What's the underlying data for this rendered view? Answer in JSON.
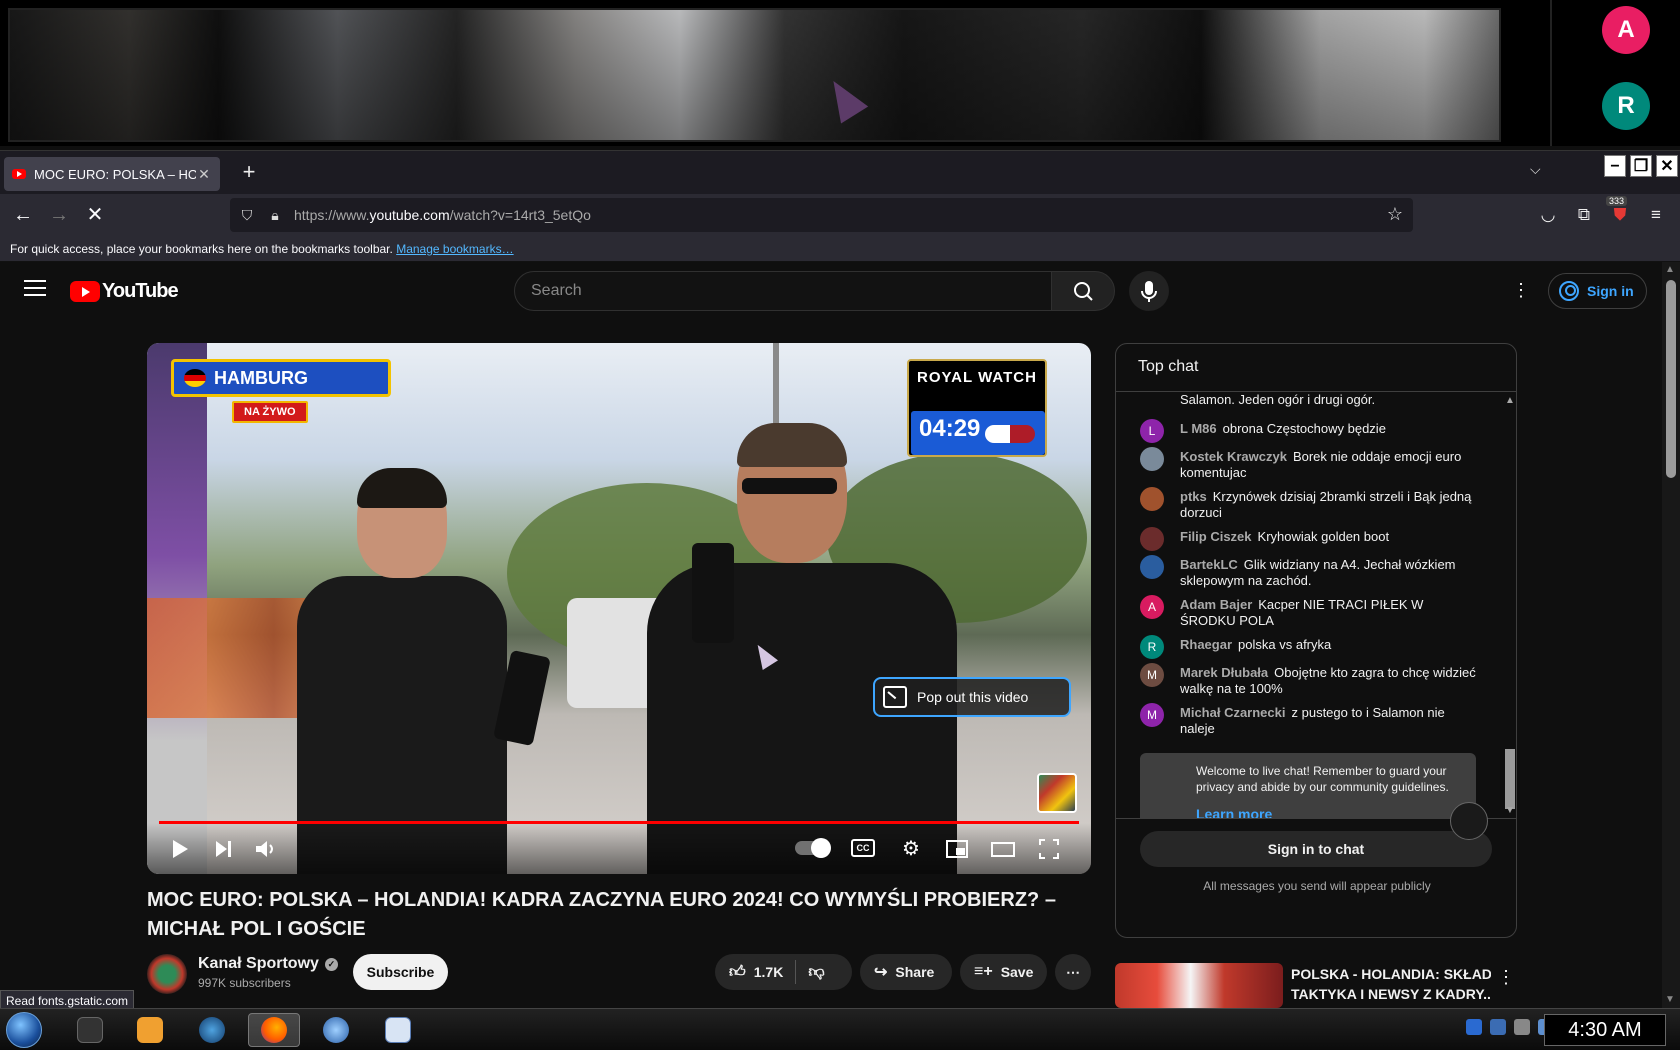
{
  "call": {
    "participants": [
      {
        "initial": "A",
        "color": "#e91e63"
      },
      {
        "initial": "R",
        "color": "#00897b"
      }
    ]
  },
  "browser": {
    "tab_title": "MOC EURO: POLSKA – HOLANDIA!",
    "url_prefix": "https://www.",
    "url_domain": "youtube.com",
    "url_path": "/watch?v=14rt3_5etQo",
    "bookmarks_text": "For quick access, place your bookmarks here on the bookmarks toolbar.",
    "bookmarks_link": "Manage bookmarks…",
    "extension_badge": "333",
    "status_text": "Read fonts.gstatic.com"
  },
  "youtube": {
    "logo_text": "YouTube",
    "search_placeholder": "Search",
    "signin_label": "Sign in",
    "video": {
      "location_badge": "HAMBURG",
      "live_badge": "NA ŻYWO",
      "overlay_brand": "ROYAL WATCH",
      "overlay_timer": "04:29",
      "popout_label": "Pop out this video",
      "cc_label": "CC",
      "title": "MOC EURO: POLSKA – HOLANDIA! KADRA ZACZYNA EURO 2024! CO WYMYŚLI PROBIERZ? – MICHAŁ POL I GOŚCIE"
    },
    "channel": {
      "name": "Kanał Sportowy",
      "subscribers": "997K subscribers",
      "subscribe_label": "Subscribe"
    },
    "actions": {
      "likes": "1.7K",
      "share": "Share",
      "save": "Save"
    },
    "chat": {
      "header": "Top chat",
      "truncated_message": "Salamon. Jeden ogór i drugi ogór.",
      "messages": [
        {
          "avatar": "L",
          "color": "#8e24aa",
          "author": "L M86",
          "text": "obrona Częstochowy będzie"
        },
        {
          "avatar": "",
          "color": "#7a8a9a",
          "author": "Kostek Krawczyk",
          "text": "Borek nie oddaje emocji euro komentujac"
        },
        {
          "avatar": "",
          "color": "#a0522d",
          "author": "ptks",
          "text": "Krzynówek dzisiaj 2bramki strzeli i Bąk jedną dorzuci"
        },
        {
          "avatar": "",
          "color": "#6b2c2c",
          "author": "Filip Ciszek",
          "text": "Kryhowiak golden boot"
        },
        {
          "avatar": "",
          "color": "#2a5d9f",
          "author": "BartekLC",
          "text": "Glik widziany na A4. Jechał wózkiem sklepowym na zachód."
        },
        {
          "avatar": "A",
          "color": "#d81b60",
          "author": "Adam Bajer",
          "text": "Kacper NIE TRACI PIŁEK W ŚRODKU POLA"
        },
        {
          "avatar": "R",
          "color": "#00897b",
          "author": "Rhaegar",
          "text": "polska vs afryka"
        },
        {
          "avatar": "M",
          "color": "#6d4c41",
          "author": "Marek Dłubała",
          "text": "Obojętne kto zagra to chcę widzieć walkę na te 100%"
        },
        {
          "avatar": "M",
          "color": "#8e24aa",
          "author": "Michał Czarnecki",
          "text": "z pustego to i Salamon nie naleje"
        }
      ],
      "welcome_text": "Welcome to live chat! Remember to guard your privacy and abide by our community guidelines.",
      "learn_more": "Learn more",
      "signin_label": "Sign in to chat",
      "note": "All messages you send will appear publicly"
    },
    "recommended": {
      "title_line1": "POLSKA - HOLANDIA: SKŁAD,",
      "title_line2": "TAKTYKA I NEWSY Z KADRY...."
    }
  },
  "taskbar": {
    "clock": "4:30 AM"
  }
}
